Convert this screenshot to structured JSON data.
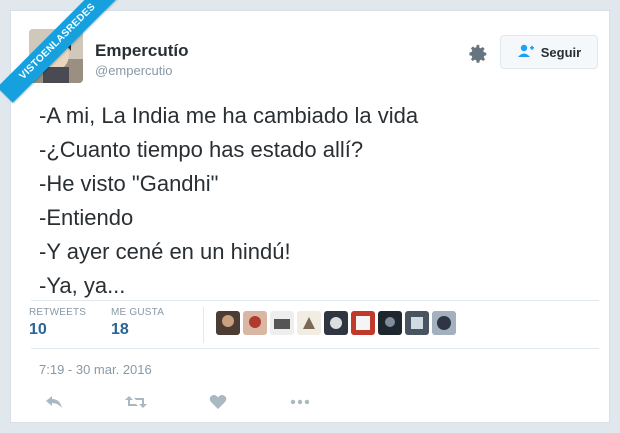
{
  "watermark": "VISTOENLASREDES",
  "user": {
    "name": "Empercutío",
    "handle": "@empercutio"
  },
  "follow_label": "Seguir",
  "tweet_lines": [
    "-A mi, La India me ha cambiado la vida",
    "-¿Cuanto tiempo has estado allí?",
    "-He visto \"Gandhi\"",
    "-Entiendo",
    "-Y ayer cené en un hindú!",
    "-Ya, ya..."
  ],
  "stats": {
    "retweets_label": "RETWEETS",
    "retweets": "10",
    "likes_label": "ME GUSTA",
    "likes": "18"
  },
  "timestamp": "7:19 - 30 mar. 2016",
  "icons": [
    "gear-icon",
    "add-user-icon",
    "reply-icon",
    "retweet-icon",
    "like-icon",
    "more-icon"
  ],
  "colors": {
    "link": "#2a6496",
    "muted": "#8899a6",
    "ribbon": "#16a1de"
  }
}
